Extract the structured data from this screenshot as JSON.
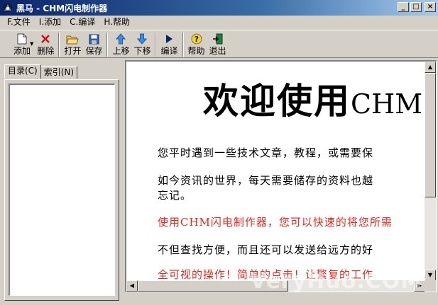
{
  "window": {
    "title": "黑马 - CHM闪电制作器",
    "minimize_label": "_",
    "maximize_label": "□",
    "close_label": "×"
  },
  "menu": [
    {
      "label": "F.文件"
    },
    {
      "label": "I.添加"
    },
    {
      "label": "C.编译"
    },
    {
      "label": "H.帮助"
    }
  ],
  "toolbar": {
    "add_label": "添加",
    "delete_label": "删除",
    "open_label": "打开",
    "save_label": "保存",
    "move_up_label": "上移",
    "move_down_label": "下移",
    "compile_label": "编译",
    "help_label": "帮助",
    "exit_label": "退出"
  },
  "left_panel": {
    "tabs": [
      {
        "label": "目录(C)"
      },
      {
        "label": "索引(N)"
      }
    ]
  },
  "document": {
    "title_zh": "欢迎使用",
    "title_en": "CHM",
    "paragraphs": [
      "您平时遇到一些技术文章，教程，或需要保",
      "如今资讯的世界，每天需要储存的资料也越",
      "忘记。",
      "使用CHM闪电制作器，您可以快速的将您所需",
      "不但查找方便，而且还可以发送给远方的好",
      "全可视的操作！简单的点击！让繁复的工作"
    ]
  },
  "watermark": "VeryHuo.COM",
  "colors": {
    "titlebar_start": "#0a246a",
    "titlebar_end": "#a6caf0",
    "red_text": "#e8281e",
    "window_face": "#d4d0c8"
  }
}
